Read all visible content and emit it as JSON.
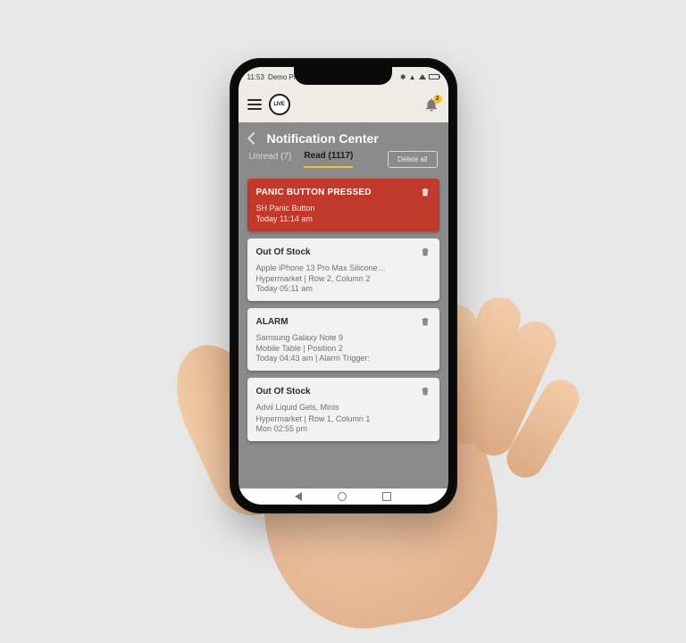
{
  "statusbar": {
    "time": "11:53",
    "device": "Demo Phone"
  },
  "appbar": {
    "logo_text": "LIVE",
    "notif_badge": "2"
  },
  "header": {
    "title": "Notification Center"
  },
  "tabs": {
    "unread_label": "Unread (7)",
    "read_label": "Read (1117)",
    "delete_all_label": "Delete all"
  },
  "cards": [
    {
      "variant": "panic",
      "title": "PANIC BUTTON PRESSED",
      "line1": "SH Panic Button",
      "line2": "",
      "ts": "Today 11:14 am"
    },
    {
      "variant": "normal",
      "title": "Out Of Stock",
      "line1": "Apple iPhone 13 Pro Max Silicone…",
      "line2": "Hypermarket  |  Row 2, Column 2",
      "ts": "Today 05:11 am"
    },
    {
      "variant": "normal",
      "title": "ALARM",
      "line1": "Samsung Galaxy Note 9",
      "line2": "Mobile Table  |  Position 2",
      "ts": "Today 04:43 am | Alarm Trigger:"
    },
    {
      "variant": "normal",
      "title": "Out Of Stock",
      "line1": "Advil Liquid Gels, Minis",
      "line2": "Hypermarket  |  Row 1, Column 1",
      "ts": "Mon 02:55 pm"
    }
  ]
}
